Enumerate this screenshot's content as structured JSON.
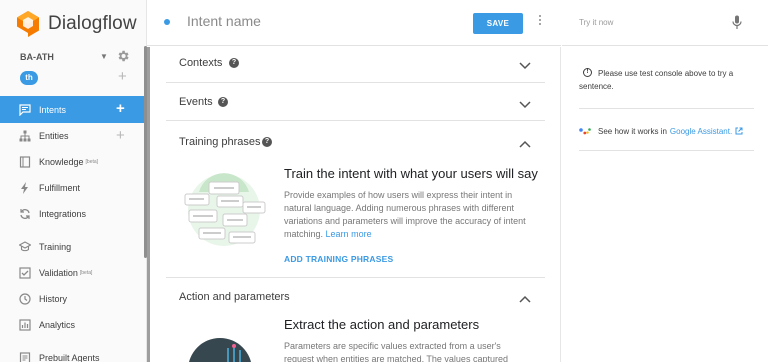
{
  "brand": {
    "name": "Dialogflow"
  },
  "agent": {
    "name": "BA-ATH",
    "language": "th"
  },
  "nav": {
    "intents": "Intents",
    "entities": "Entities",
    "knowledge": "Knowledge",
    "knowledge_badge": "[beta]",
    "fulfillment": "Fulfillment",
    "integrations": "Integrations",
    "training": "Training",
    "validation": "Validation",
    "validation_badge": "[beta]",
    "history": "History",
    "analytics": "Analytics",
    "prebuilt": "Prebuilt Agents"
  },
  "header": {
    "intent_placeholder": "Intent name",
    "save_label": "SAVE"
  },
  "sections": {
    "contexts": "Contexts",
    "events": "Events",
    "training_phrases": "Training phrases",
    "training_heading": "Train the intent with what your users will say",
    "training_desc": "Provide examples of how users will express their intent in natural language. Adding numerous phrases with different variations and parameters will improve the accuracy of intent matching.",
    "learn_more": "Learn more",
    "add_phrases": "ADD TRAINING PHRASES",
    "action_params": "Action and parameters",
    "action_heading": "Extract the action and parameters",
    "action_desc_1": "Parameters are specific values extracted from a user's",
    "action_desc_2": "request when entities are matched. The values captured"
  },
  "right_panel": {
    "try_it": "Try it now",
    "info": "Please use test console above to try a sentence.",
    "ga_text": "See how it works in",
    "ga_link": "Google Assistant."
  },
  "colors": {
    "accent": "#3a9ae3",
    "brand_orange": "#f57c00"
  }
}
